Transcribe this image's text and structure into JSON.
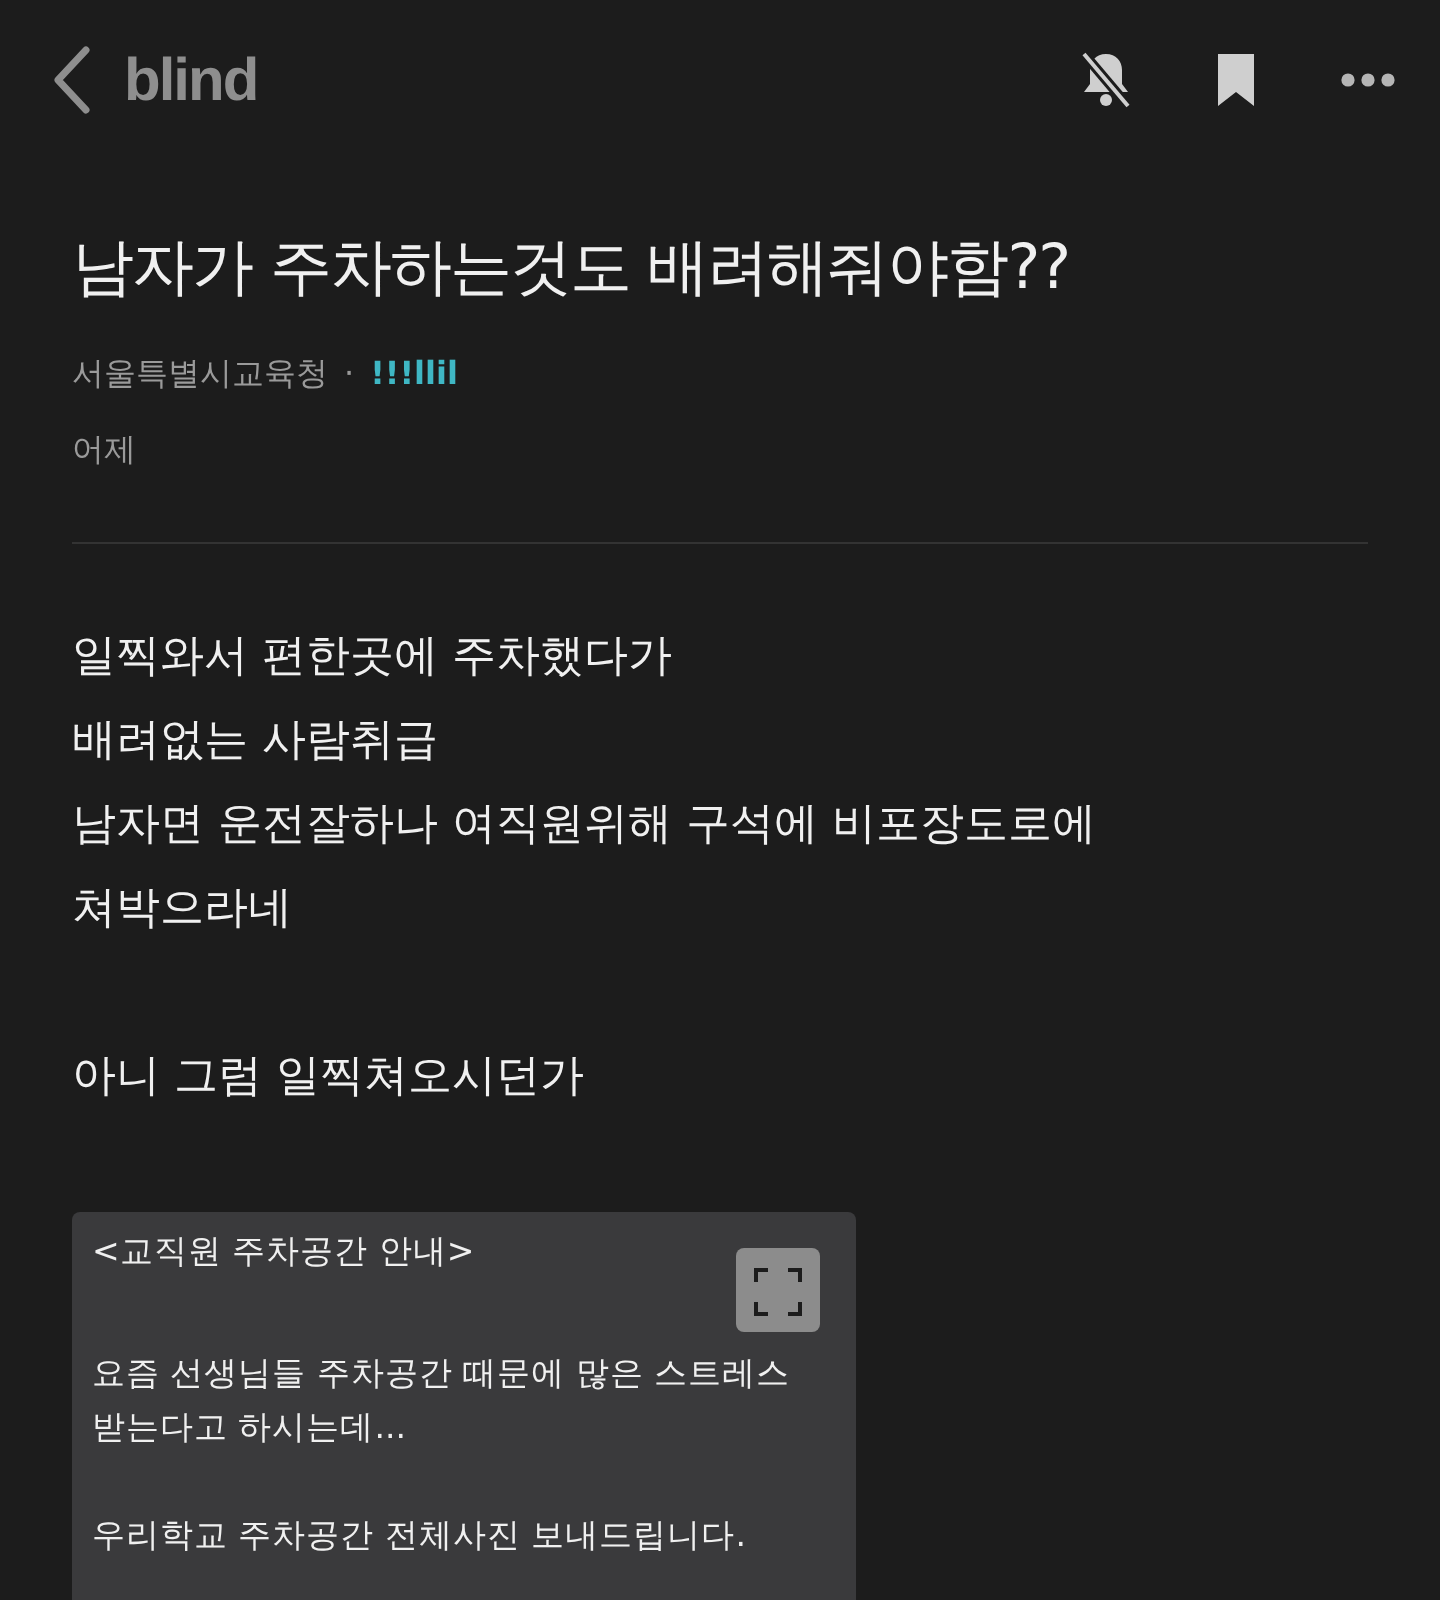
{
  "top_bar": {
    "logo": "blind",
    "notifications_muted": true
  },
  "post": {
    "title": "남자가 주차하는것도 배려해줘야함??",
    "company": "서울특별시교육청",
    "separator": "·",
    "author": "!!!llil",
    "date": "어제",
    "paragraphs": [
      [
        "일찍와서 편한곳에 주차했다가",
        "배려없는 사람취급",
        "남자면 운전잘하나 여직원위해 구석에 비포장도로에",
        "쳐박으라네"
      ],
      [
        "아니 그럼 일찍쳐오시던가"
      ]
    ],
    "attachment": {
      "paragraphs": [
        [
          "<교직원 주차공간 안내>"
        ],
        [
          "요즘 선생님들 주차공간 때문에 많은 스트레스",
          "받는다고 하시는데..."
        ],
        [
          "우리학교 주차공간 전체사진 보내드립니다."
        ]
      ]
    }
  }
}
